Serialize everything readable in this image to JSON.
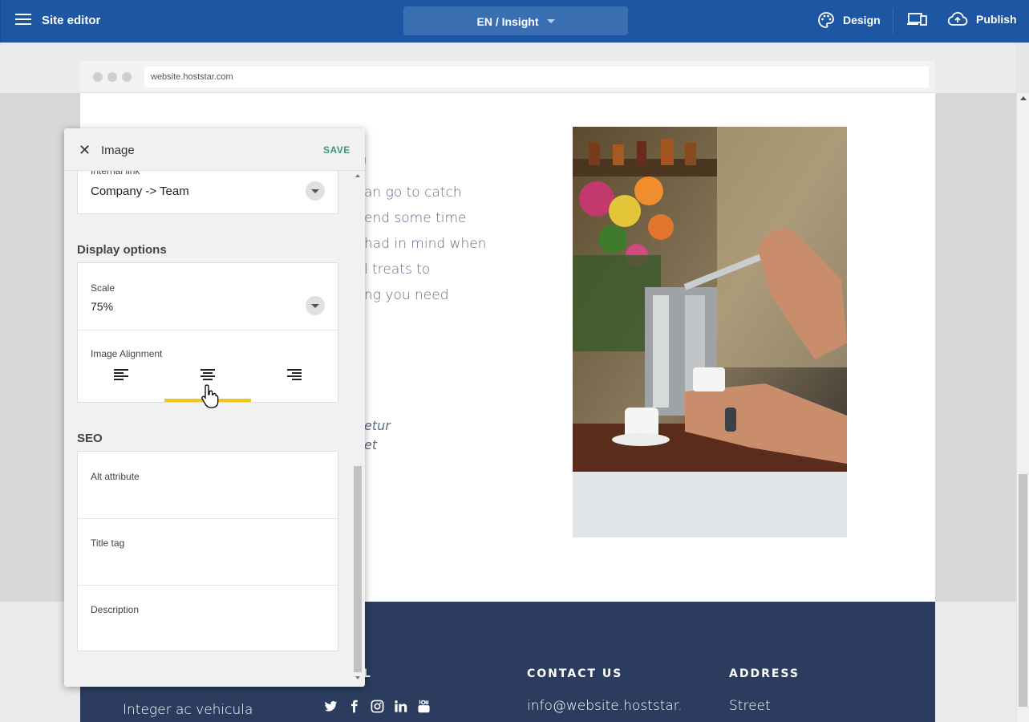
{
  "topbar": {
    "title": "Site editor",
    "language_page": "EN / Insight",
    "design_label": "Design",
    "publish_label": "Publish",
    "color": "#1d56a3"
  },
  "browser": {
    "url": "website.hoststar.com"
  },
  "page": {
    "text_lines": [
      "an go to catch",
      "end some time",
      "had in mind when",
      "l treats to",
      "ng you need"
    ],
    "italic_lines": [
      "etur",
      "et"
    ]
  },
  "footer": {
    "col1_heading": "AL",
    "col1_text": "Integer ac vehicula",
    "col2_heading": "CONTACT US",
    "col2_text": "info@website.hoststar.",
    "col3_heading": "ADDRESS",
    "col3_text": "Street",
    "social_icons": [
      "twitter-icon",
      "facebook-icon",
      "instagram-icon",
      "linkedin-icon",
      "youtube-icon"
    ],
    "color": "#2b3c5e"
  },
  "panel": {
    "title": "Image",
    "save_label": "SAVE",
    "internal_link": {
      "label": "Internal link",
      "value": "Company -> Team"
    },
    "display_options": {
      "title": "Display options",
      "scale_label": "Scale",
      "scale_value": "75%",
      "alignment_label": "Image Alignment",
      "alignment_options": [
        "left",
        "center",
        "right"
      ],
      "alignment_selected": "center",
      "accent": "#f0c419"
    },
    "seo": {
      "title": "SEO",
      "alt_label": "Alt attribute",
      "title_tag_label": "Title tag",
      "description_label": "Description"
    }
  }
}
